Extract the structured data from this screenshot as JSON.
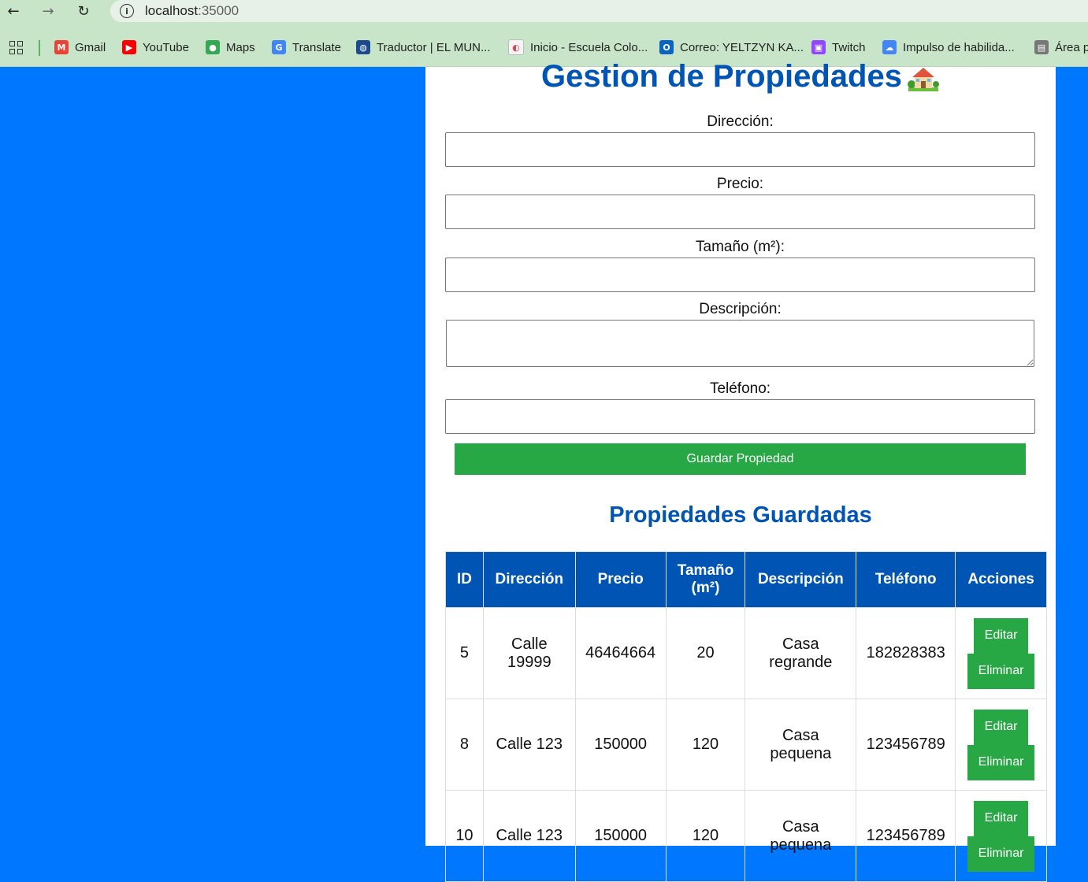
{
  "browser": {
    "url_host": "localhost",
    "url_port": ":35000",
    "bookmarks": [
      {
        "label": "Gmail",
        "icon": "gmail-icon",
        "color": "#ea4335"
      },
      {
        "label": "YouTube",
        "icon": "youtube-icon",
        "color": "#ff0000"
      },
      {
        "label": "Maps",
        "icon": "maps-icon",
        "color": "#34a853"
      },
      {
        "label": "Translate",
        "icon": "translate-icon",
        "color": "#4285f4"
      },
      {
        "label": "Traductor | EL MUN...",
        "icon": "globe-icon",
        "color": "#1a4b8c"
      },
      {
        "label": "Inicio - Escuela Colo...",
        "icon": "school-icon",
        "color": "#f5f5f5"
      },
      {
        "label": "Correo: YELTZYN KA...",
        "icon": "outlook-icon",
        "color": "#0a64c2"
      },
      {
        "label": "Twitch",
        "icon": "twitch-icon",
        "color": "#9146ff"
      },
      {
        "label": "Impulso de habilida...",
        "icon": "cloud-icon",
        "color": "#4285f4"
      },
      {
        "label": "Área p",
        "icon": "document-icon",
        "color": "#777777"
      }
    ]
  },
  "page": {
    "title": "Gestion de Propiedades",
    "form": {
      "direccion_label": "Dirección:",
      "precio_label": "Precio:",
      "tamano_label": "Tamaño (m²):",
      "descripcion_label": "Descripción:",
      "telefono_label": "Teléfono:",
      "direccion_value": "",
      "precio_value": "",
      "tamano_value": "",
      "descripcion_value": "",
      "telefono_value": "",
      "save_label": "Guardar Propiedad"
    },
    "list_title": "Propiedades Guardadas",
    "table": {
      "headers": [
        "ID",
        "Dirección",
        "Precio",
        "Tamaño (m²)",
        "Descripción",
        "Teléfono",
        "Acciones"
      ],
      "rows": [
        {
          "id": "5",
          "direccion": "Calle 19999",
          "precio": "46464664",
          "tamano": "20",
          "descripcion": "Casa regrande",
          "telefono": "182828383"
        },
        {
          "id": "8",
          "direccion": "Calle 123",
          "precio": "150000",
          "tamano": "120",
          "descripcion": "Casa pequena",
          "telefono": "123456789"
        },
        {
          "id": "10",
          "direccion": "Calle 123",
          "precio": "150000",
          "tamano": "120",
          "descripcion": "Casa pequena",
          "telefono": "123456789"
        }
      ],
      "edit_label": "Editar",
      "delete_label": "Eliminar"
    }
  }
}
